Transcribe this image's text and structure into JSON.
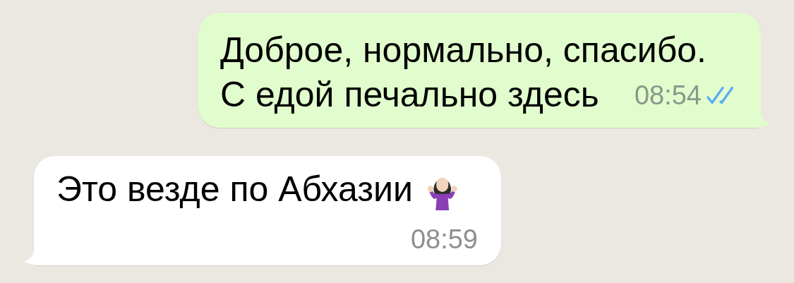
{
  "messages": [
    {
      "kind": "outgoing",
      "lines": [
        "Доброе, нормально, спасибо.",
        "С едой печально здесь"
      ],
      "time": "08:54",
      "read": true,
      "emoji": false
    },
    {
      "kind": "incoming",
      "lines": [
        "Это везде по Абхазии"
      ],
      "time": "08:59",
      "emoji": true
    }
  ]
}
